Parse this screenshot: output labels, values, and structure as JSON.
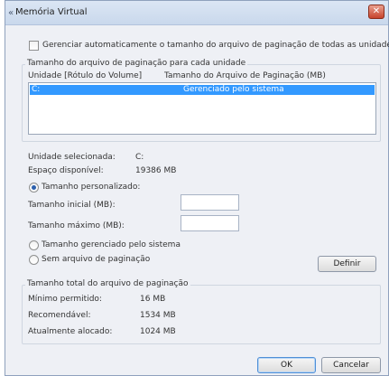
{
  "window": {
    "title": "Memória Virtual",
    "close_glyph": "✕"
  },
  "auto_manage": {
    "label": "Gerenciar automaticamente o tamanho do arquivo de paginação de todas as unidades",
    "checked": false
  },
  "per_drive": {
    "section_label": "Tamanho do arquivo de paginação para cada unidade",
    "columns": [
      "Unidade [Rótulo do Volume]",
      "Tamanho do Arquivo de Paginação (MB)"
    ],
    "rows": [
      {
        "drive": "C:",
        "size": "Gerenciado pelo sistema",
        "selected": true
      }
    ]
  },
  "selected_drive": {
    "drive_label": "Unidade selecionada:",
    "drive_value": "C:",
    "space_label": "Espaço disponível:",
    "space_value": "19386 MB"
  },
  "size_options": {
    "custom_label": "Tamanho personalizado:",
    "initial_label": "Tamanho inicial (MB):",
    "initial_value": "",
    "max_label": "Tamanho máximo (MB):",
    "max_value": "",
    "system_managed_label": "Tamanho gerenciado pelo sistema",
    "no_paging_label": "Sem arquivo de paginação",
    "selected": "custom",
    "set_button": "Definir"
  },
  "totals": {
    "section_label": "Tamanho total do arquivo de paginação",
    "min_label": "Mínimo permitido:",
    "min_value": "16 MB",
    "recommended_label": "Recomendável:",
    "recommended_value": "1534 MB",
    "allocated_label": "Atualmente alocado:",
    "allocated_value": "1024 MB"
  },
  "buttons": {
    "ok": "OK",
    "cancel": "Cancelar"
  }
}
